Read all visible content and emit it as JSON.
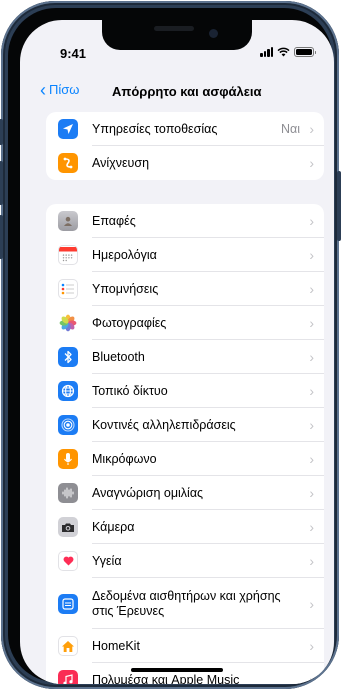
{
  "status": {
    "time": "9:41"
  },
  "nav": {
    "back_label": "Πίσω",
    "title": "Απόρρητο και ασφάλεια"
  },
  "groups": [
    {
      "items": [
        {
          "label": "Υπηρεσίες τοποθεσίας",
          "value": "Ναι",
          "icon": "location-arrow-icon",
          "color": "#1c7cf4"
        },
        {
          "label": "Ανίχνευση",
          "icon": "tracking-icon",
          "color": "#ff9500"
        }
      ]
    },
    {
      "items": [
        {
          "label": "Επαφές",
          "icon": "contacts-icon",
          "color": "#a3a3a8"
        },
        {
          "label": "Ημερολόγια",
          "icon": "calendar-icon",
          "color": "#ffffff"
        },
        {
          "label": "Υπομνήσεις",
          "icon": "reminders-icon",
          "color": "#ffffff"
        },
        {
          "label": "Φωτογραφίες",
          "icon": "photos-icon",
          "color": "#ffffff"
        },
        {
          "label": "Bluetooth",
          "icon": "bluetooth-icon",
          "color": "#1c7cf4"
        },
        {
          "label": "Τοπικό δίκτυο",
          "icon": "globe-icon",
          "color": "#1c7cf4"
        },
        {
          "label": "Κοντινές αλληλεπιδράσεις",
          "icon": "nearby-icon",
          "color": "#1c7cf4"
        },
        {
          "label": "Μικρόφωνο",
          "icon": "microphone-icon",
          "color": "#ff9500"
        },
        {
          "label": "Αναγνώριση ομιλίας",
          "icon": "waveform-icon",
          "color": "#8e8e93"
        },
        {
          "label": "Κάμερα",
          "icon": "camera-icon",
          "color": "#3a3a3c"
        },
        {
          "label": "Υγεία",
          "icon": "heart-icon",
          "color": "#ffffff"
        },
        {
          "label": "Δεδομένα αισθητήρων και χρήσης στις Έρευνες",
          "icon": "research-icon",
          "color": "#1c7cf4"
        },
        {
          "label": "HomeKit",
          "icon": "home-icon",
          "color": "#ff9f0a"
        },
        {
          "label": "Πολυμέσα και Apple Music",
          "icon": "music-icon",
          "color": "#fa2d55"
        }
      ]
    }
  ]
}
